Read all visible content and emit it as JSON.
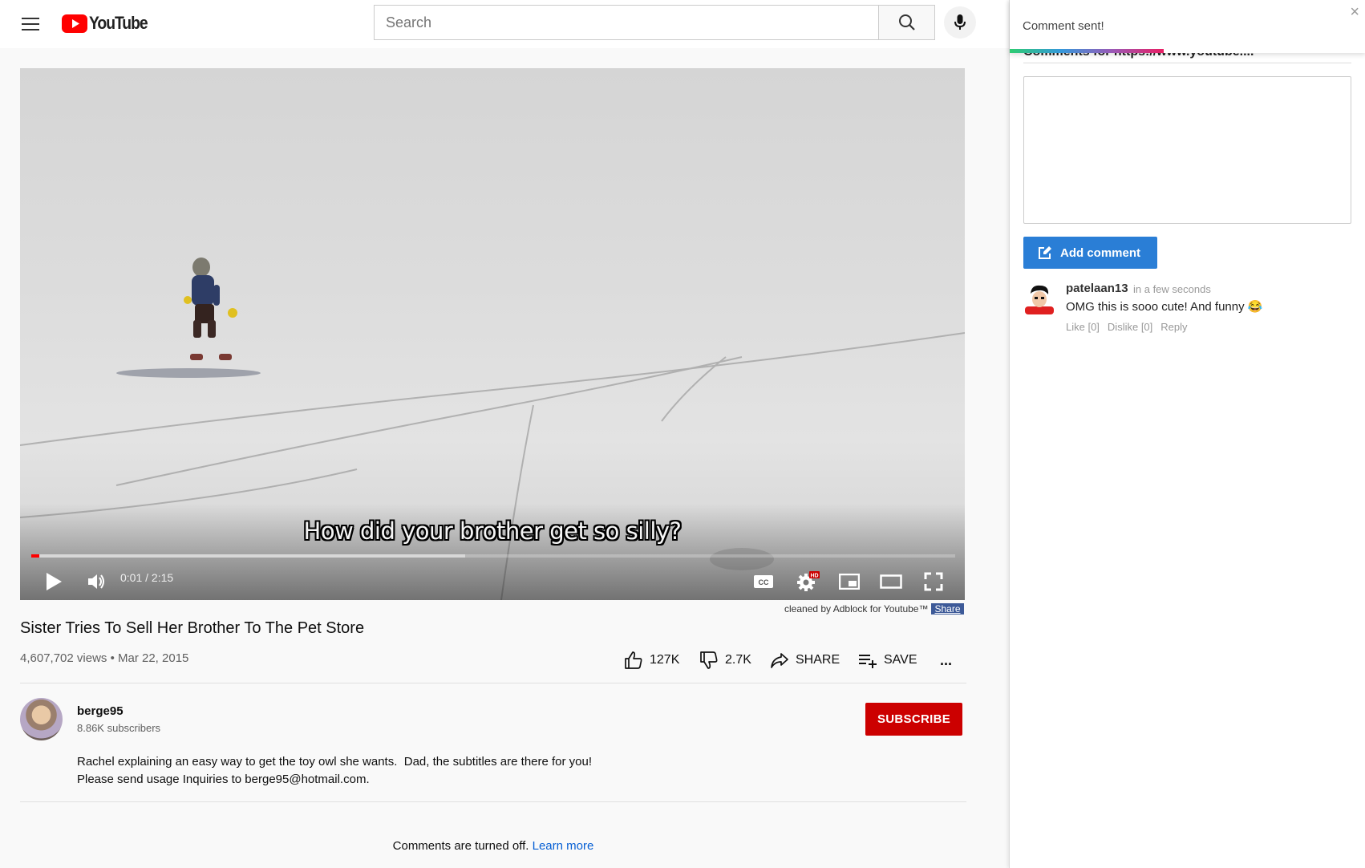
{
  "header": {
    "logo_text": "YouTube",
    "search_placeholder": "Search"
  },
  "player": {
    "subtitle": "How did your brother get so silly?",
    "time_display": "0:01 / 2:15",
    "progress_played": 0.009,
    "progress_loaded": 0.47,
    "hd_badge": "HD",
    "cc_label": "CC"
  },
  "adblock": {
    "note": "cleaned by Adblock for Youtube™",
    "share": "Share"
  },
  "video": {
    "title": "Sister Tries To Sell Her Brother To The Pet Store",
    "meta": "4,607,702 views • Mar 22, 2015",
    "likes": "127K",
    "dislikes": "2.7K",
    "share_label": "SHARE",
    "save_label": "SAVE",
    "more_label": "..."
  },
  "channel": {
    "name": "berge95",
    "subscribers": "8.86K subscribers",
    "subscribe_label": "SUBSCRIBE",
    "description": "Rachel explaining an easy way to get the toy owl she wants.  Dad, the subtitles are there for you!\nPlease send usage Inquiries to berge95@hotmail.com."
  },
  "comments_notice": {
    "text": "Comments are turned off. ",
    "link": "Learn more"
  },
  "panel": {
    "toast_text": "Comment sent!",
    "toast_close": "×",
    "heading": "Comments for https://www.youtube....",
    "add_comment_label": "Add comment",
    "comment": {
      "user": "patelaan13",
      "time": "in a few seconds",
      "text": "OMG this is sooo cute! And funny 😂",
      "like": "Like [0]",
      "dislike": "Dislike [0]",
      "reply": "Reply"
    }
  },
  "colors": {
    "youtube_red": "#ff0000",
    "subscribe_red": "#cc0000",
    "add_button_blue": "#2a7ed6",
    "link_blue": "#065fd4"
  }
}
